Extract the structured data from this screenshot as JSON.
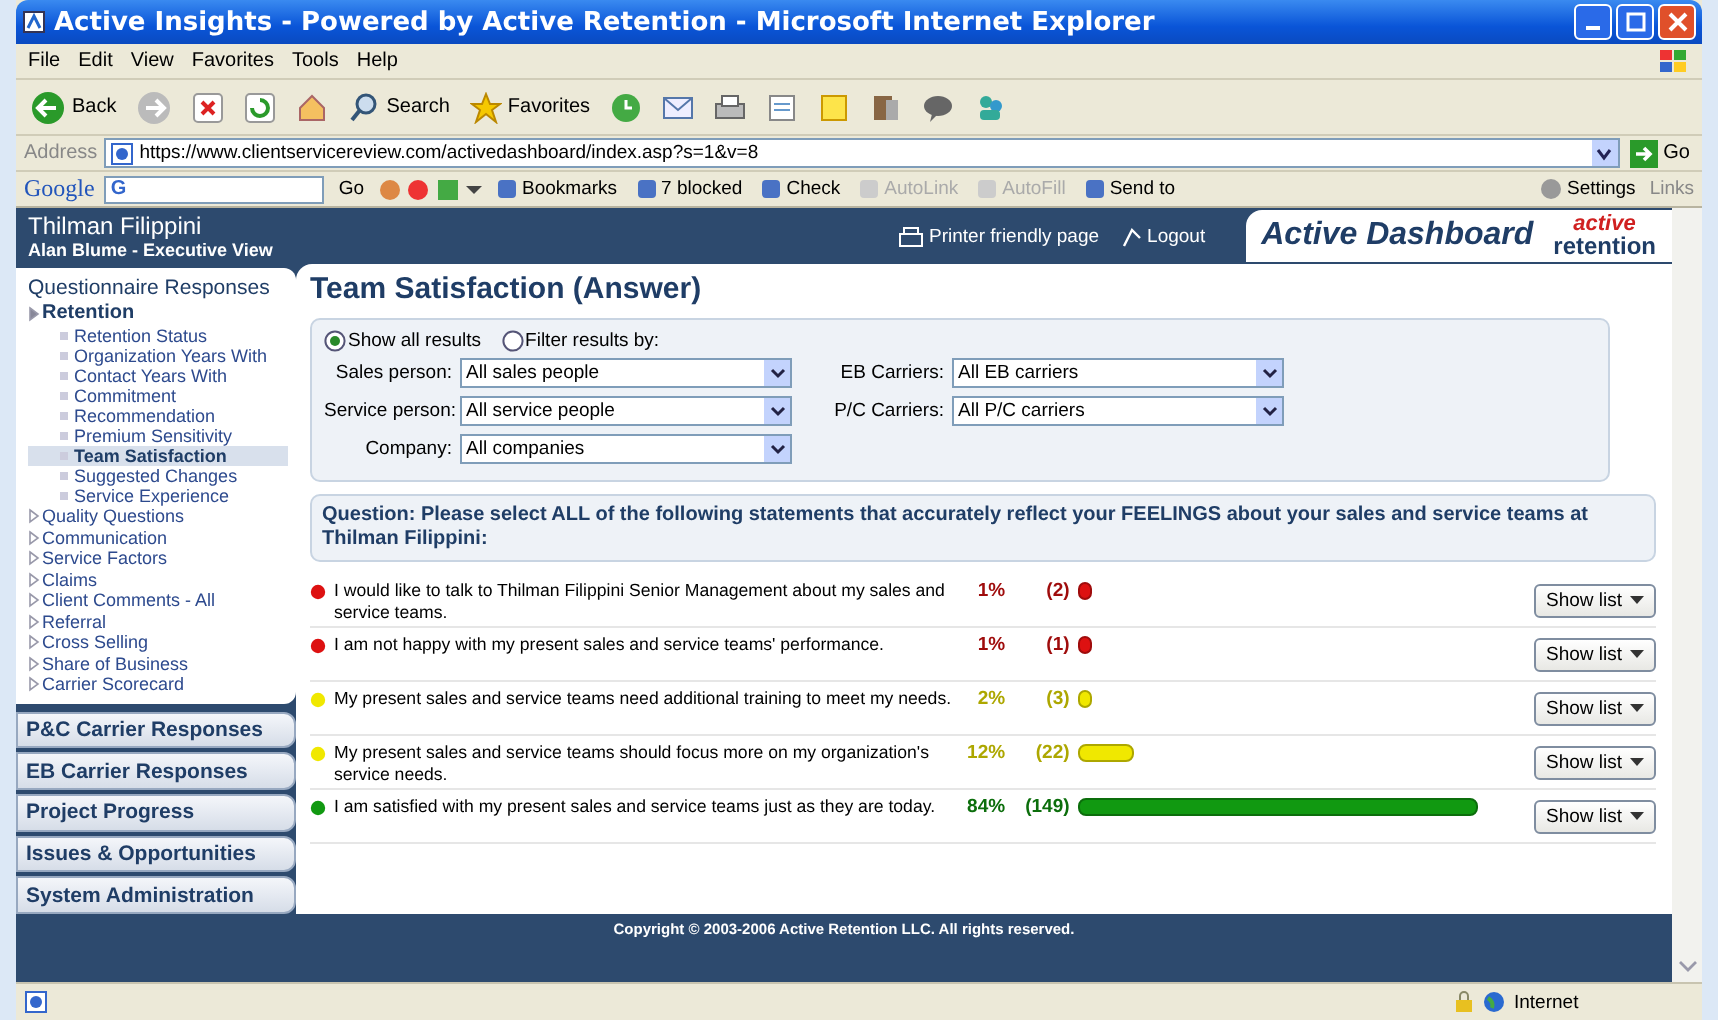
{
  "window": {
    "title": "Active Insights - Powered by Active Retention - Microsoft Internet Explorer"
  },
  "menu": [
    "File",
    "Edit",
    "View",
    "Favorites",
    "Tools",
    "Help"
  ],
  "toolbar": [
    {
      "kind": "back",
      "label": "Back"
    },
    {
      "kind": "forward"
    },
    {
      "kind": "stop"
    },
    {
      "kind": "refresh"
    },
    {
      "kind": "home"
    },
    {
      "kind": "search",
      "label": "Search"
    },
    {
      "kind": "favorites",
      "label": "Favorites"
    },
    {
      "kind": "history"
    },
    {
      "kind": "mail"
    },
    {
      "kind": "print"
    },
    {
      "kind": "edit"
    },
    {
      "kind": "notes"
    },
    {
      "kind": "research"
    },
    {
      "kind": "messenger"
    },
    {
      "kind": "people"
    }
  ],
  "address": {
    "label": "Address",
    "url": "https://www.clientservicereview.com/activedashboard/index.asp?s=1&v=8",
    "go": "Go"
  },
  "google_bar": {
    "brand": "Google",
    "search_button": "G",
    "go": "Go",
    "items": [
      {
        "label": "Bookmarks",
        "disabled": false
      },
      {
        "label": "7 blocked",
        "disabled": false
      },
      {
        "label": "Check",
        "disabled": false
      },
      {
        "label": "AutoLink",
        "disabled": true
      },
      {
        "label": "AutoFill",
        "disabled": true
      },
      {
        "label": "Send to",
        "disabled": false
      }
    ],
    "settings": "Settings",
    "links": "Links"
  },
  "header": {
    "client": "Thilman Filippini",
    "user": "Alan Blume - Executive View",
    "links": [
      "Printer friendly page",
      "Logout"
    ],
    "app_title": "Active Dashboard",
    "logo": {
      "top": "active",
      "bottom": "retention"
    }
  },
  "sidebar": {
    "sections": [
      {
        "title": "Questionnaire Responses",
        "expanded": true,
        "items": [
          {
            "label": "Retention",
            "expanded": true,
            "children": [
              {
                "label": "Retention Status",
                "selected": false
              },
              {
                "label": "Organization Years With",
                "selected": false
              },
              {
                "label": "Contact Years With",
                "selected": false
              },
              {
                "label": "Commitment",
                "selected": false
              },
              {
                "label": "Recommendation",
                "selected": false
              },
              {
                "label": "Premium Sensitivity",
                "selected": false
              },
              {
                "label": "Team Satisfaction",
                "selected": true
              },
              {
                "label": "Suggested Changes",
                "selected": false
              },
              {
                "label": "Service Experience",
                "selected": false
              }
            ]
          },
          {
            "label": "Quality Questions",
            "expanded": false
          },
          {
            "label": "Communication",
            "expanded": false
          },
          {
            "label": "Service Factors",
            "expanded": false
          },
          {
            "label": "Claims",
            "expanded": false
          },
          {
            "label": "Client Comments - All",
            "expanded": false
          },
          {
            "label": "Referral",
            "expanded": false
          },
          {
            "label": "Cross Selling",
            "expanded": false
          },
          {
            "label": "Share of Business",
            "expanded": false
          },
          {
            "label": "Carrier Scorecard",
            "expanded": false
          }
        ]
      },
      {
        "title": "P&C Carrier Responses",
        "expanded": false
      },
      {
        "title": "EB Carrier Responses",
        "expanded": false
      },
      {
        "title": "Project Progress",
        "expanded": false
      },
      {
        "title": "Issues & Opportunities",
        "expanded": false
      },
      {
        "title": "System Administration",
        "expanded": false
      }
    ]
  },
  "page": {
    "title": "Team Satisfaction (Answer)",
    "filter": {
      "options": [
        {
          "label": "Show all results",
          "selected": true
        },
        {
          "label": "Filter results by:",
          "selected": false
        }
      ],
      "fields": [
        {
          "label": "Sales person:",
          "value": "All sales people"
        },
        {
          "label": "EB Carriers:",
          "value": "All EB carriers"
        },
        {
          "label": "Service person:",
          "value": "All service people"
        },
        {
          "label": "P/C Carriers:",
          "value": "All P/C carriers"
        },
        {
          "label": "Company:",
          "value": "All companies"
        }
      ]
    },
    "question": "Question: Please select ALL of the following statements that accurately reflect your FEELINGS about your sales and service teams at Thilman Filippini:",
    "answers": [
      {
        "text": "I would like to talk to Thilman Filippini Senior Management about my sales and service teams.",
        "percent": "1%",
        "count": "(2)",
        "color": "#dd1111",
        "button": "Show list"
      },
      {
        "text": "I am not happy with my present sales and service teams' performance.",
        "percent": "1%",
        "count": "(1)",
        "color": "#dd1111",
        "button": "Show list"
      },
      {
        "text": "My present sales and service teams need additional training to meet my needs.",
        "percent": "2%",
        "count": "(3)",
        "color": "#f0e800",
        "button": "Show list"
      },
      {
        "text": "My present sales and service teams should focus more on my organization's service needs.",
        "percent": "12%",
        "count": "(22)",
        "color": "#f0e800",
        "button": "Show list"
      },
      {
        "text": "I am satisfied with my present sales and service teams just as they are today.",
        "percent": "84%",
        "count": "(149)",
        "color": "#119911",
        "button": "Show list"
      }
    ]
  },
  "footer": "Copyright © 2003-2006 Active Retention LLC.  All rights reserved.",
  "status_bar": {
    "zone": "Internet"
  }
}
